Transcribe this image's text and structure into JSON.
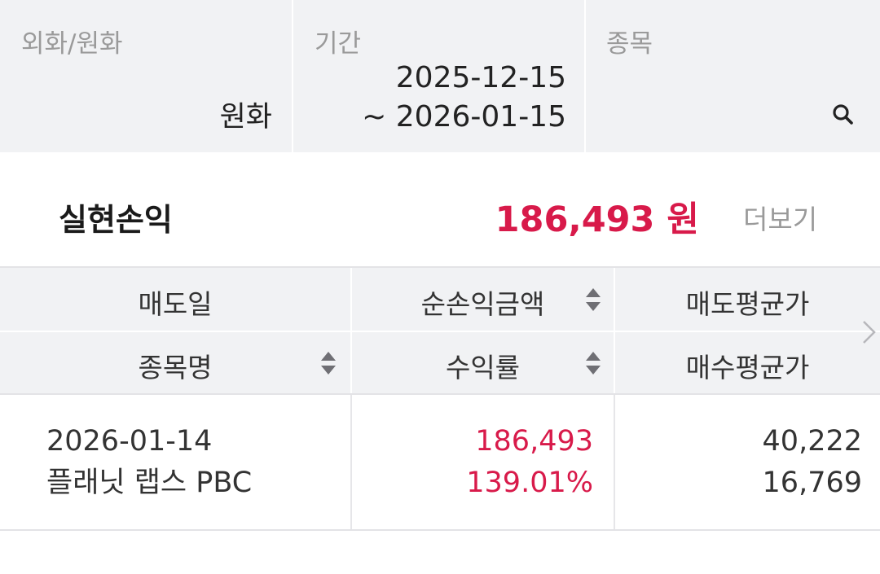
{
  "filters": {
    "currency": {
      "label": "외화/원화",
      "value": "원화"
    },
    "period": {
      "label": "기간",
      "start": "2025-12-15",
      "end": "~ 2026-01-15"
    },
    "stock": {
      "label": "종목",
      "icon": "search-icon"
    }
  },
  "summary": {
    "title": "실현손익",
    "amount": "186,493 원",
    "amount_color": "#d81a4a",
    "more": "더보기"
  },
  "table": {
    "headers": {
      "row1": [
        "매도일",
        "순손익금액",
        "매도평균가"
      ],
      "row2": [
        "종목명",
        "수익률",
        "매수평균가"
      ]
    },
    "rows": [
      {
        "sell_date": "2026-01-14",
        "name": "플래닛 랩스 PBC",
        "net_profit": "186,493",
        "return_rate": "139.01%",
        "sell_avg": "40,222",
        "buy_avg": "16,769"
      }
    ]
  }
}
